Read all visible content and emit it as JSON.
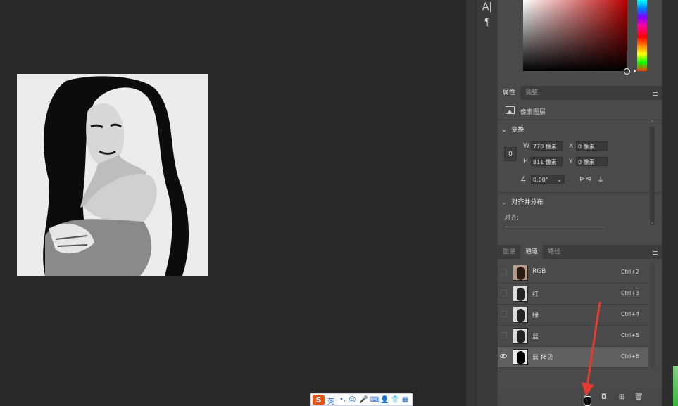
{
  "toolbar": {
    "type_tool": "A|",
    "paragraph_tool": "¶"
  },
  "properties_panel": {
    "tabs": [
      {
        "label": "属性",
        "active": true
      },
      {
        "label": "调整",
        "active": false
      }
    ],
    "layer_type": "像素图层",
    "transform": {
      "heading": "变换",
      "w_label": "W",
      "w_value": "770 像素",
      "h_label": "H",
      "h_value": "811 像素",
      "x_label": "X",
      "x_value": "0 像素",
      "y_label": "Y",
      "y_value": "0 像素",
      "angle_value": "0.00°"
    },
    "align": {
      "heading": "对齐并分布",
      "label": "对齐:"
    }
  },
  "channels_panel": {
    "tabs": [
      {
        "label": "图层",
        "active": false
      },
      {
        "label": "通道",
        "active": true
      },
      {
        "label": "路径",
        "active": false
      }
    ],
    "channels": [
      {
        "name": "RGB",
        "shortcut": "Ctrl+2",
        "visible": false,
        "selected": false
      },
      {
        "name": "红",
        "shortcut": "Ctrl+3",
        "visible": false,
        "selected": false
      },
      {
        "name": "绿",
        "shortcut": "Ctrl+4",
        "visible": false,
        "selected": false
      },
      {
        "name": "蓝",
        "shortcut": "Ctrl+5",
        "visible": false,
        "selected": false
      },
      {
        "name": "蓝 拷贝",
        "shortcut": "Ctrl+6",
        "visible": true,
        "selected": true
      }
    ]
  },
  "ime": {
    "logo": "S",
    "mode": "英",
    "punct": "•,"
  },
  "colors": {
    "accent_red": "#e53a2e",
    "panel_bg": "#4a4a4a",
    "selected_row": "#606060"
  }
}
